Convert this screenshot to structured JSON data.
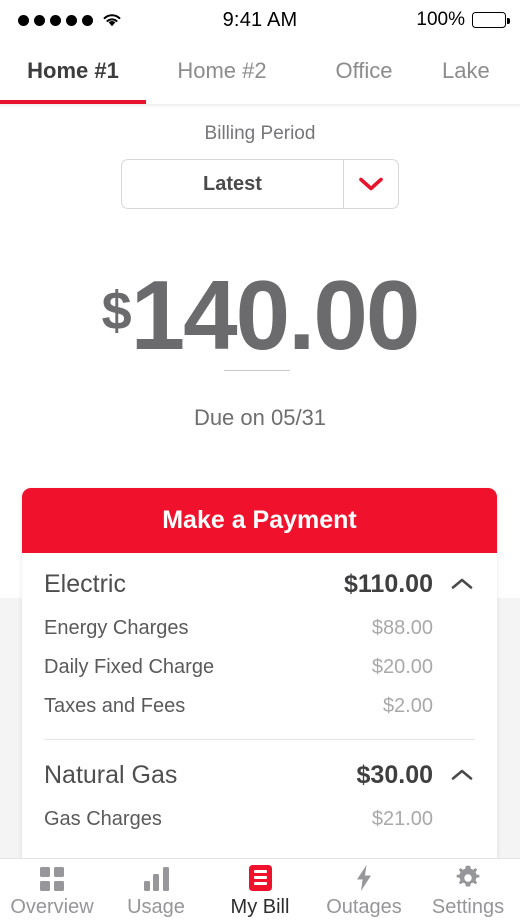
{
  "status_bar": {
    "signal_dots": 5,
    "signal_icon": "signal-dots-icon",
    "wifi_icon": "wifi-icon",
    "time": "9:41 AM",
    "battery_percent": "100%",
    "battery_icon": "battery-full-icon"
  },
  "top_tabs": {
    "items": [
      {
        "label": "Home #1",
        "active": true
      },
      {
        "label": "Home #2",
        "active": false
      },
      {
        "label": "Office",
        "active": false
      },
      {
        "label": "Lake",
        "active": false
      }
    ],
    "active_indicator_color": "#e8142d"
  },
  "billing": {
    "label": "Billing Period",
    "selected": "Latest",
    "chevron_icon": "chevron-down-icon",
    "chevron_color": "#e8142d"
  },
  "amount_due": {
    "currency": "$",
    "value": "140.00",
    "due_text": "Due on 05/31"
  },
  "card": {
    "pay_button_label": "Make a Payment",
    "pay_button_color": "#f0122c",
    "sections": [
      {
        "name": "Electric",
        "amount": "$110.00",
        "chevron_icon": "chevron-up-icon",
        "items": [
          {
            "name": "Energy Charges",
            "amount": "$88.00"
          },
          {
            "name": "Daily Fixed Charge",
            "amount": "$20.00"
          },
          {
            "name": "Taxes and Fees",
            "amount": "$2.00"
          }
        ]
      },
      {
        "name": "Natural Gas",
        "amount": "$30.00",
        "chevron_icon": "chevron-up-icon",
        "items": [
          {
            "name": "Gas Charges",
            "amount": "$21.00"
          }
        ]
      }
    ]
  },
  "bottom_nav": {
    "items": [
      {
        "label": "Overview",
        "icon": "grid-icon",
        "active": false
      },
      {
        "label": "Usage",
        "icon": "bar-chart-icon",
        "active": false
      },
      {
        "label": "My Bill",
        "icon": "bill-document-icon",
        "active": true
      },
      {
        "label": "Outages",
        "icon": "lightning-bolt-icon",
        "active": false
      },
      {
        "label": "Settings",
        "icon": "gear-icon",
        "active": false
      }
    ],
    "active_color": "#f0122c"
  }
}
